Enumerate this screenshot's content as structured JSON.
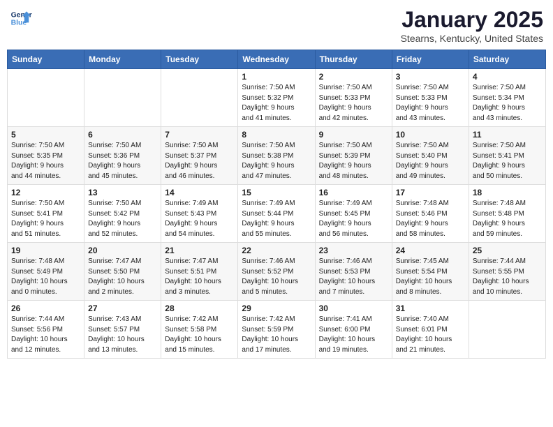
{
  "logo": {
    "line1": "General",
    "line2": "Blue"
  },
  "title": "January 2025",
  "subtitle": "Stearns, Kentucky, United States",
  "weekdays": [
    "Sunday",
    "Monday",
    "Tuesday",
    "Wednesday",
    "Thursday",
    "Friday",
    "Saturday"
  ],
  "weeks": [
    [
      {
        "day": "",
        "info": ""
      },
      {
        "day": "",
        "info": ""
      },
      {
        "day": "",
        "info": ""
      },
      {
        "day": "1",
        "info": "Sunrise: 7:50 AM\nSunset: 5:32 PM\nDaylight: 9 hours\nand 41 minutes."
      },
      {
        "day": "2",
        "info": "Sunrise: 7:50 AM\nSunset: 5:33 PM\nDaylight: 9 hours\nand 42 minutes."
      },
      {
        "day": "3",
        "info": "Sunrise: 7:50 AM\nSunset: 5:33 PM\nDaylight: 9 hours\nand 43 minutes."
      },
      {
        "day": "4",
        "info": "Sunrise: 7:50 AM\nSunset: 5:34 PM\nDaylight: 9 hours\nand 43 minutes."
      }
    ],
    [
      {
        "day": "5",
        "info": "Sunrise: 7:50 AM\nSunset: 5:35 PM\nDaylight: 9 hours\nand 44 minutes."
      },
      {
        "day": "6",
        "info": "Sunrise: 7:50 AM\nSunset: 5:36 PM\nDaylight: 9 hours\nand 45 minutes."
      },
      {
        "day": "7",
        "info": "Sunrise: 7:50 AM\nSunset: 5:37 PM\nDaylight: 9 hours\nand 46 minutes."
      },
      {
        "day": "8",
        "info": "Sunrise: 7:50 AM\nSunset: 5:38 PM\nDaylight: 9 hours\nand 47 minutes."
      },
      {
        "day": "9",
        "info": "Sunrise: 7:50 AM\nSunset: 5:39 PM\nDaylight: 9 hours\nand 48 minutes."
      },
      {
        "day": "10",
        "info": "Sunrise: 7:50 AM\nSunset: 5:40 PM\nDaylight: 9 hours\nand 49 minutes."
      },
      {
        "day": "11",
        "info": "Sunrise: 7:50 AM\nSunset: 5:41 PM\nDaylight: 9 hours\nand 50 minutes."
      }
    ],
    [
      {
        "day": "12",
        "info": "Sunrise: 7:50 AM\nSunset: 5:41 PM\nDaylight: 9 hours\nand 51 minutes."
      },
      {
        "day": "13",
        "info": "Sunrise: 7:50 AM\nSunset: 5:42 PM\nDaylight: 9 hours\nand 52 minutes."
      },
      {
        "day": "14",
        "info": "Sunrise: 7:49 AM\nSunset: 5:43 PM\nDaylight: 9 hours\nand 54 minutes."
      },
      {
        "day": "15",
        "info": "Sunrise: 7:49 AM\nSunset: 5:44 PM\nDaylight: 9 hours\nand 55 minutes."
      },
      {
        "day": "16",
        "info": "Sunrise: 7:49 AM\nSunset: 5:45 PM\nDaylight: 9 hours\nand 56 minutes."
      },
      {
        "day": "17",
        "info": "Sunrise: 7:48 AM\nSunset: 5:46 PM\nDaylight: 9 hours\nand 58 minutes."
      },
      {
        "day": "18",
        "info": "Sunrise: 7:48 AM\nSunset: 5:48 PM\nDaylight: 9 hours\nand 59 minutes."
      }
    ],
    [
      {
        "day": "19",
        "info": "Sunrise: 7:48 AM\nSunset: 5:49 PM\nDaylight: 10 hours\nand 0 minutes."
      },
      {
        "day": "20",
        "info": "Sunrise: 7:47 AM\nSunset: 5:50 PM\nDaylight: 10 hours\nand 2 minutes."
      },
      {
        "day": "21",
        "info": "Sunrise: 7:47 AM\nSunset: 5:51 PM\nDaylight: 10 hours\nand 3 minutes."
      },
      {
        "day": "22",
        "info": "Sunrise: 7:46 AM\nSunset: 5:52 PM\nDaylight: 10 hours\nand 5 minutes."
      },
      {
        "day": "23",
        "info": "Sunrise: 7:46 AM\nSunset: 5:53 PM\nDaylight: 10 hours\nand 7 minutes."
      },
      {
        "day": "24",
        "info": "Sunrise: 7:45 AM\nSunset: 5:54 PM\nDaylight: 10 hours\nand 8 minutes."
      },
      {
        "day": "25",
        "info": "Sunrise: 7:44 AM\nSunset: 5:55 PM\nDaylight: 10 hours\nand 10 minutes."
      }
    ],
    [
      {
        "day": "26",
        "info": "Sunrise: 7:44 AM\nSunset: 5:56 PM\nDaylight: 10 hours\nand 12 minutes."
      },
      {
        "day": "27",
        "info": "Sunrise: 7:43 AM\nSunset: 5:57 PM\nDaylight: 10 hours\nand 13 minutes."
      },
      {
        "day": "28",
        "info": "Sunrise: 7:42 AM\nSunset: 5:58 PM\nDaylight: 10 hours\nand 15 minutes."
      },
      {
        "day": "29",
        "info": "Sunrise: 7:42 AM\nSunset: 5:59 PM\nDaylight: 10 hours\nand 17 minutes."
      },
      {
        "day": "30",
        "info": "Sunrise: 7:41 AM\nSunset: 6:00 PM\nDaylight: 10 hours\nand 19 minutes."
      },
      {
        "day": "31",
        "info": "Sunrise: 7:40 AM\nSunset: 6:01 PM\nDaylight: 10 hours\nand 21 minutes."
      },
      {
        "day": "",
        "info": ""
      }
    ]
  ]
}
